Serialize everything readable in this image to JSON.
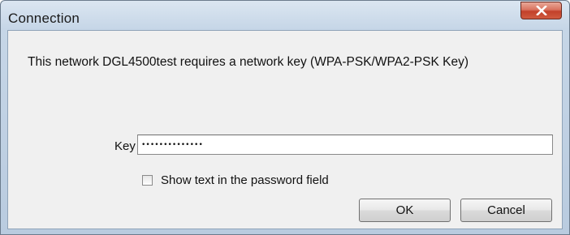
{
  "window": {
    "title": "Connection",
    "close_icon": "close-icon"
  },
  "dialog": {
    "message": "This network DGL4500test requires a network key (WPA-PSK/WPA2-PSK Key)",
    "key_label": "Key",
    "key_value": "••••••••••••••",
    "show_password_label": "Show text in the password field",
    "show_password_checked": false,
    "ok_label": "OK",
    "cancel_label": "Cancel"
  }
}
